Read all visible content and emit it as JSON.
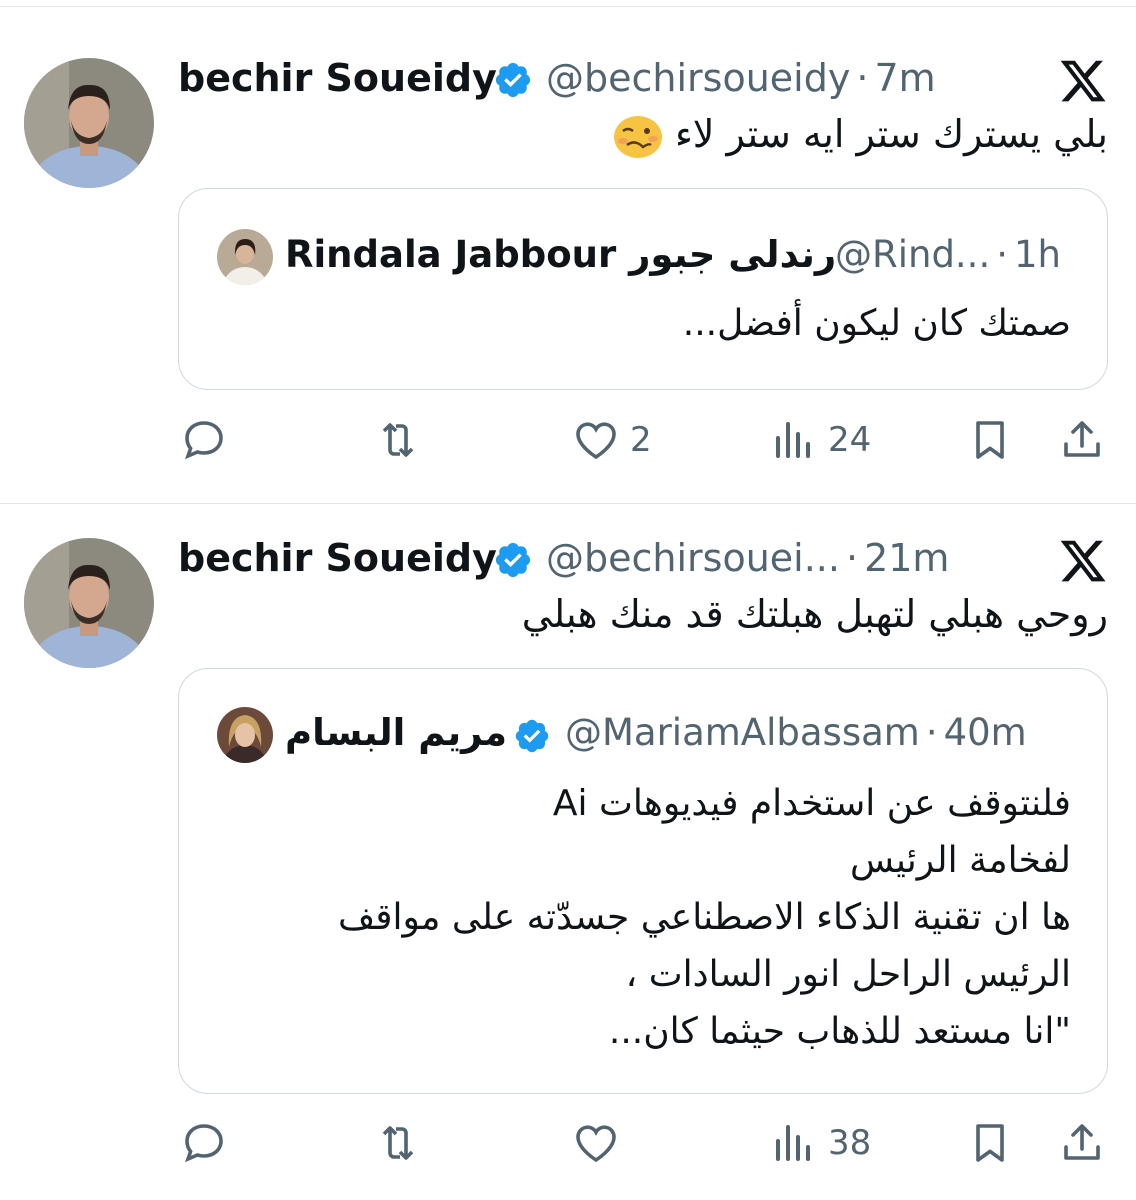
{
  "tweets": [
    {
      "author_name": "bechir Soueidy",
      "handle": "@bechirsoueidy",
      "separator": "·",
      "time": "7m",
      "text": "بلي يسترك ستر ايه ستر لاء",
      "emoji": "woozy-face",
      "quote": {
        "author_name": "Rindala Jabbour رندلى جبور",
        "handle": "@Rind...",
        "separator": "·",
        "time": "1h",
        "verified": false,
        "lines": [
          "صمتك كان ليكون أفضل..."
        ]
      },
      "metrics": {
        "replies": "",
        "retweets": "",
        "likes": "2",
        "views": "24"
      }
    },
    {
      "author_name": "bechir Soueidy",
      "handle": "@bechirsouei...",
      "separator": "·",
      "time": "21m",
      "text": "روحي هبلي لتهبل هبلتك قد منك هبلي",
      "quote": {
        "author_name": "مريم البسام",
        "handle": "@MariamAlbassam",
        "separator": "·",
        "time": "40m",
        "verified": true,
        "lines": [
          "فلنتوقف عن استخدام فيديوهات Ai",
          "لفخامة الرئيس",
          "ها ان  تقنية الذكاء الاصطناعي جسدّته  على مواقف",
          "الرئيس الراحل انور السادات ،",
          "\"انا مستعد للذهاب حيثما  كان..."
        ]
      },
      "metrics": {
        "replies": "",
        "retweets": "",
        "likes": "",
        "views": "38"
      }
    }
  ],
  "icons": {
    "verified": "verified-badge-icon",
    "platform": "x-logo-icon",
    "reply": "reply-icon",
    "retweet": "retweet-icon",
    "like": "heart-icon",
    "views": "views-icon",
    "bookmark": "bookmark-icon",
    "share": "share-icon"
  },
  "colors": {
    "verified": "#1d9bf0",
    "secondary_text": "#536471",
    "border": "#cfd9de"
  }
}
